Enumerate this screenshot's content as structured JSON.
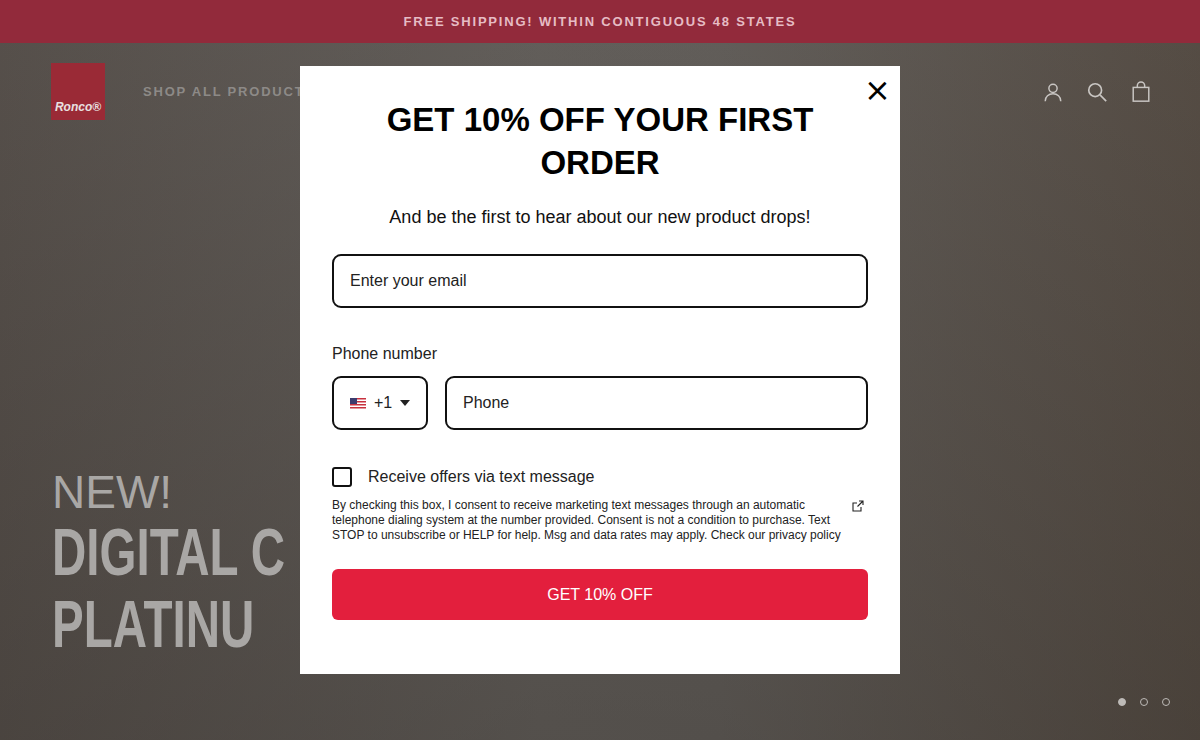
{
  "announcement": "FREE SHIPPING! WITHIN CONTIGUOUS 48 STATES",
  "header": {
    "logo": "Ronco®",
    "nav": [
      "SHOP ALL PRODUCTS"
    ]
  },
  "hero": {
    "kicker": "NEW!",
    "lines": [
      "DIGITAL C",
      "PLATINU"
    ],
    "slides": [
      {
        "selected": true
      },
      {
        "selected": false
      },
      {
        "selected": false
      }
    ]
  },
  "modal": {
    "close": "×",
    "title": "GET 10% OFF YOUR FIRST ORDER",
    "subtitle": "And be the first to hear about our new product drops!",
    "email_placeholder": "Enter your email",
    "phone_label": "Phone number",
    "country_code": "+1",
    "phone_placeholder": "Phone",
    "sms_checkbox": {
      "label": "Receive offers via text message",
      "checked": false
    },
    "legal": "By checking this box, I consent to receive marketing text messages through an automatic telephone dialing system at the number provided. Consent is not a condition to purchase. Text STOP to unsubscribe or HELP for help. Msg and data rates may apply. Check our privacy policy",
    "submit": "GET 10% OFF"
  }
}
